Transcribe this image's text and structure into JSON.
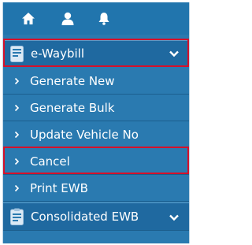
{
  "topbar": {
    "icons": [
      "home-icon",
      "user-icon",
      "bell-icon"
    ]
  },
  "menu": {
    "ewaybill": {
      "label": "e-Waybill",
      "icon": "document-icon",
      "expanded": true
    },
    "items": [
      {
        "label": "Generate New"
      },
      {
        "label": "Generate Bulk"
      },
      {
        "label": "Update Vehicle No"
      },
      {
        "label": "Cancel"
      },
      {
        "label": "Print EWB"
      }
    ],
    "consolidated": {
      "label": "Consolidated EWB",
      "icon": "clipboard-icon"
    }
  },
  "colors": {
    "menu_bg": "#2a7ab0",
    "header_bg": "#1f69a0",
    "highlight": "#d6102a",
    "text": "#ffffff"
  }
}
